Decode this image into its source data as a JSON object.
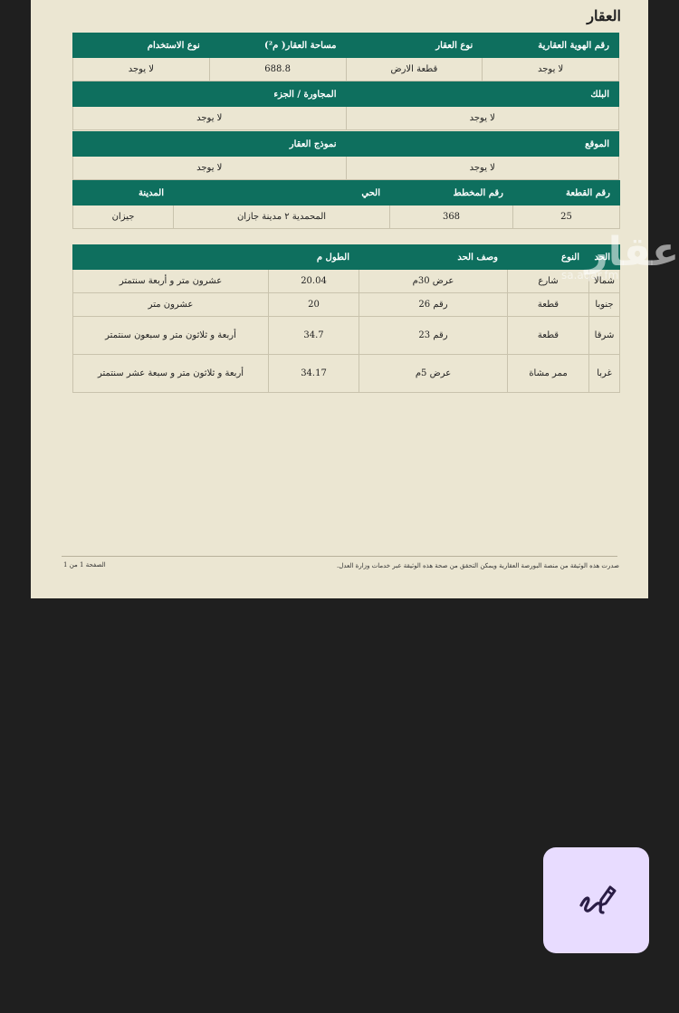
{
  "document": {
    "section_title": "العقار",
    "property_info": {
      "headers": [
        "رقم الهوية العقارية",
        "نوع العقار",
        "مساحة العقار( م²)",
        "نوع الاستخدام"
      ],
      "values": [
        "لا يوجد",
        "قطعة الارض",
        "688.8",
        "لا يوجد"
      ]
    },
    "block_info": {
      "headers": [
        "البلك",
        "المجاورة / الجزء"
      ],
      "values": [
        "لا يوجد",
        "لا يوجد"
      ]
    },
    "location_info": {
      "headers": [
        "الموقع",
        "نموذج العقار"
      ],
      "values": [
        "لا يوجد",
        "لا يوجد"
      ]
    },
    "plot_info": {
      "headers": [
        "رقم القطعة",
        "رقم المخطط",
        "الحي",
        "المدينة"
      ],
      "values": [
        "25",
        "368",
        "المحمدية ٢ مدينة جازان",
        "جيزان"
      ]
    },
    "boundaries": {
      "headers": [
        "الحد",
        "النوع",
        "وصف الحد",
        "الطول م"
      ],
      "rows": [
        [
          "شمالا",
          "شارع",
          "عرض 30م",
          "20.04",
          "عشرون متر و أربعة سنتمتر"
        ],
        [
          "جنوبا",
          "قطعة",
          "رقم 26",
          "20",
          "عشرون متر"
        ],
        [
          "شرقا",
          "قطعة",
          "رقم 23",
          "34.7",
          "أربعة و ثلاثون متر و سبعون سنتمتر"
        ],
        [
          "غربا",
          "ممر مشاة",
          "عرض 5م",
          "34.17",
          "أربعة و ثلاثون متر و سبعة عشر سنتمتر"
        ]
      ]
    },
    "footer_note": "صدرت هذه الوثيقة من منصة البورصة العقارية ويمكن التحقق من صحة هذه الوثيقة عبر خدمات وزارة العدل.",
    "page_indicator": "الصفحة 1 من 1"
  },
  "watermark": {
    "logo_text": "عقار",
    "url": "sa.aqar.fm"
  },
  "fab": {
    "icon": "draw-pen-icon",
    "background": "#e8dcff"
  },
  "colors": {
    "header_green": "#0e6f5e",
    "paper": "#ebe6d2",
    "viewer_bg": "#1f1f1f"
  }
}
